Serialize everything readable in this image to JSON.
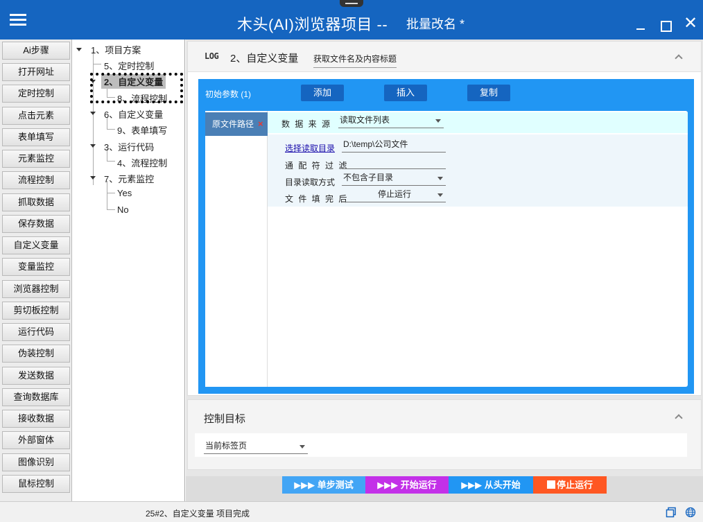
{
  "window": {
    "title": "木头(AI)浏览器项目  --",
    "subtitle": "批量改名 *"
  },
  "sidebar": {
    "items": [
      "Ai步骤",
      "打开网址",
      "定时控制",
      "点击元素",
      "表单填写",
      "元素监控",
      "流程控制",
      "抓取数据",
      "保存数据",
      "自定义变量",
      "变量监控",
      "浏览器控制",
      "剪切板控制",
      "运行代码",
      "伪装控制",
      "发送数据",
      "查询数据库",
      "接收数据",
      "外部窗体",
      "图像识别",
      "鼠标控制"
    ]
  },
  "tree": {
    "n1": "1、项目方案",
    "n5": "5、定时控制",
    "n2": "2、自定义变量",
    "n8": "8、流程控制",
    "n6": "6、自定义变量",
    "n9": "9、表单填写",
    "n3": "3、运行代码",
    "n4": "4、流程控制",
    "n7": "7、元素监控",
    "yes": "Yes",
    "no": "No"
  },
  "step": {
    "log_icon": "LOG",
    "title": "2、自定义变量",
    "link": "获取文件名及内容标题"
  },
  "params": {
    "label": "初始参数 (1)",
    "add": "添加",
    "insert": "插入",
    "copy": "复制",
    "tab": "原文件路径",
    "tab_close": "×",
    "source_label": "数 据 来 源",
    "source_value": "读取文件列表",
    "dir_link": "选择读取目录",
    "dir_value": "D:\\temp\\公司文件",
    "wildcard_label": "通 配 符 过 滤",
    "wildcard_value": "",
    "mode_label": "目录读取方式",
    "mode_value": "不包含子目录",
    "after_label": "文 件 填 完 后",
    "after_value": "停止运行"
  },
  "control": {
    "title": "控制目标",
    "target_value": "当前标签页"
  },
  "run": {
    "step": "▶▶▶ 单步测试",
    "start": "▶▶▶ 开始运行",
    "restart": "▶▶▶ 从头开始",
    "stop": "停止运行"
  },
  "colors": {
    "title_bar": "#1565c0",
    "panel": "#2196f3",
    "step_btn": "#42a5f5",
    "start_btn": "#c330e8",
    "restart_btn": "#2196f3",
    "stop_btn": "#ff5722"
  },
  "status": {
    "text": "25#2、自定义变量 项目完成"
  }
}
